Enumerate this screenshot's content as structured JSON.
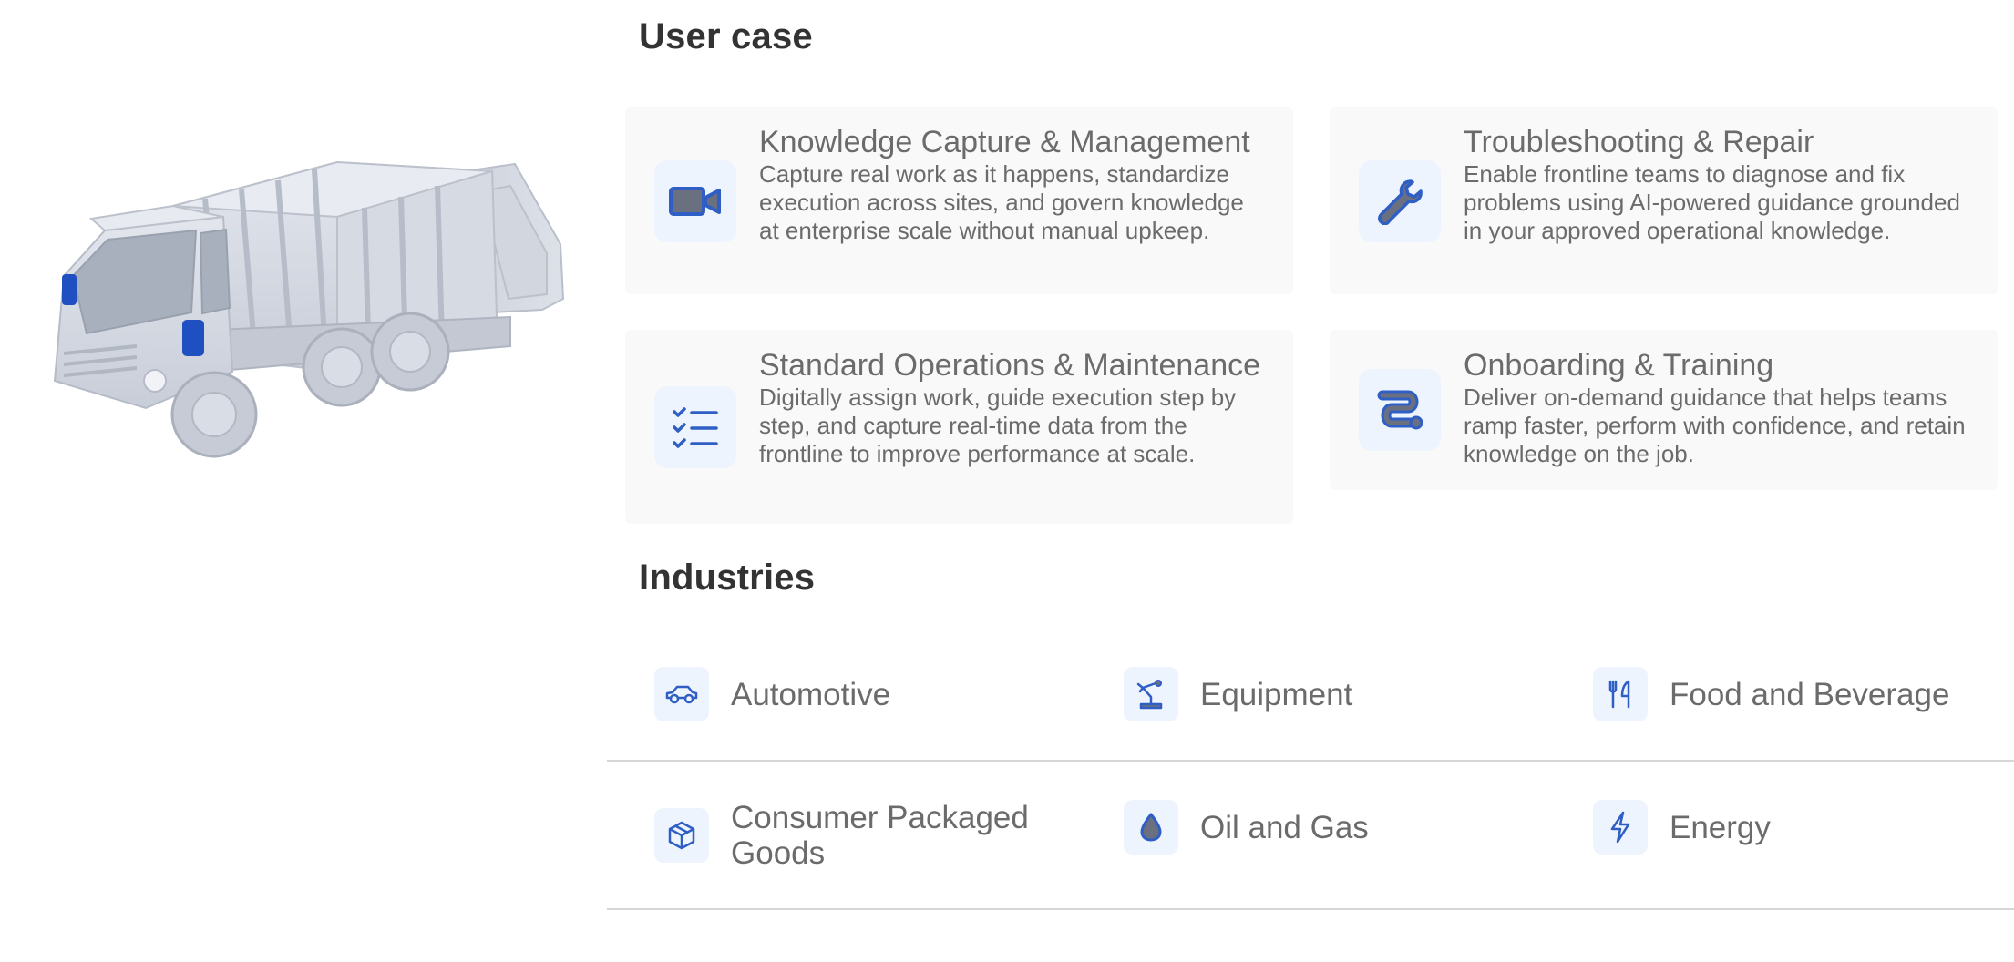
{
  "colors": {
    "accent": "#2f5fc4",
    "icon_bg": "#eef4fd",
    "card_bg": "#f9f9f9",
    "heading": "#333333",
    "body_text": "#6b6b6b",
    "truck_body": "#d5d9e3",
    "truck_accent": "#1f4fc0"
  },
  "illustration": {
    "icon": "garbage-truck-illustration"
  },
  "use_case": {
    "title": "User case",
    "cards": [
      {
        "icon": "video-camera-icon",
        "title": "Knowledge Capture & Management",
        "description": "Capture real work as it happens, standardize execution across sites, and govern knowledge at enterprise scale without manual upkeep."
      },
      {
        "icon": "wrench-icon",
        "title": "Troubleshooting & Repair",
        "description": "Enable frontline teams to diagnose and fix problems using AI-powered guidance grounded in your approved operational knowledge."
      },
      {
        "icon": "checklist-icon",
        "title": "Standard Operations & Maintenance",
        "description": "Digitally assign work, guide execution step by step, and capture real-time data from the frontline to improve performance at scale."
      },
      {
        "icon": "route-icon",
        "title": "Onboarding & Training",
        "description": "Deliver on-demand guidance that helps teams ramp faster, perform with confidence, and retain knowledge on the job."
      }
    ]
  },
  "industries": {
    "title": "Industries",
    "items": [
      {
        "icon": "car-icon",
        "label": "Automotive"
      },
      {
        "icon": "robot-arm-icon",
        "label": "Equipment"
      },
      {
        "icon": "fork-knife-icon",
        "label": "Food and Beverage"
      },
      {
        "icon": "package-box-icon",
        "label": "Consumer Packaged Goods"
      },
      {
        "icon": "oil-drop-icon",
        "label": "Oil and Gas"
      },
      {
        "icon": "lightning-bolt-icon",
        "label": "Energy"
      }
    ]
  }
}
